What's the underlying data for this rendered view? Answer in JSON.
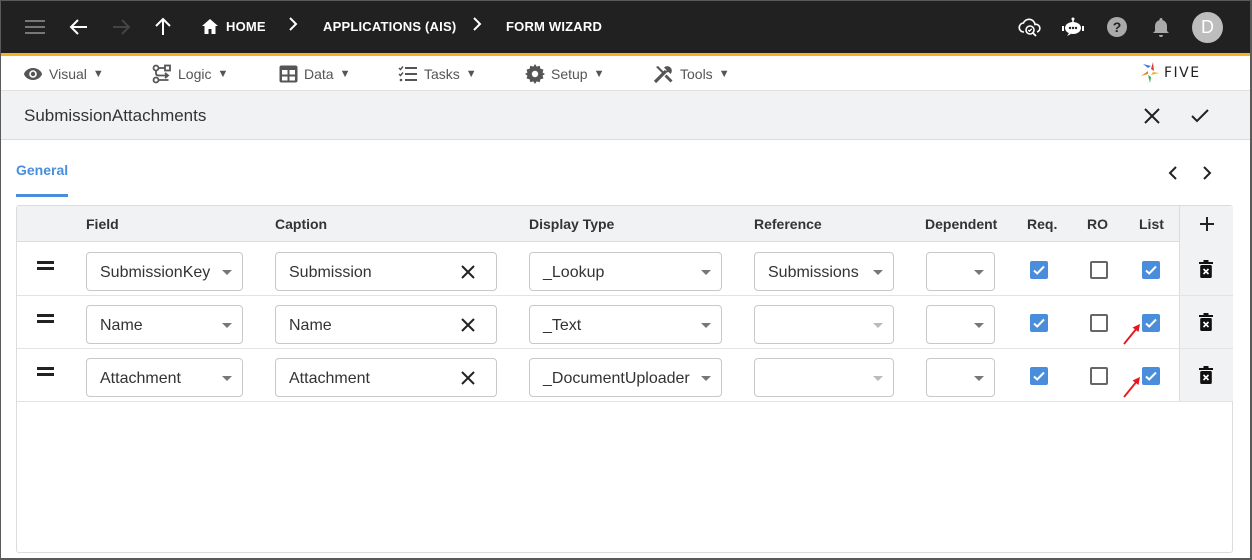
{
  "topbar": {
    "breadcrumbs": [
      "HOME",
      "APPLICATIONS (AIS)",
      "FORM WIZARD"
    ],
    "icons": [
      "menu-icon",
      "back-icon",
      "forward-icon",
      "up-icon",
      "home-icon",
      "cloud-search-icon",
      "chatbot-icon",
      "help-icon",
      "bell-icon"
    ],
    "avatar_initial": "D"
  },
  "menubar": {
    "items": [
      {
        "label": "Visual",
        "icon": "eye-icon"
      },
      {
        "label": "Logic",
        "icon": "logic-icon"
      },
      {
        "label": "Data",
        "icon": "table-icon"
      },
      {
        "label": "Tasks",
        "icon": "tasks-icon"
      },
      {
        "label": "Setup",
        "icon": "gear-icon"
      },
      {
        "label": "Tools",
        "icon": "tools-icon"
      }
    ],
    "caret": "▼",
    "logo_text": "FIVE"
  },
  "form": {
    "title": "SubmissionAttachments",
    "tabs": [
      "General"
    ],
    "active_tab": "General"
  },
  "table": {
    "headers": {
      "field": "Field",
      "caption": "Caption",
      "display_type": "Display Type",
      "reference": "Reference",
      "dependent": "Dependent",
      "req": "Req.",
      "ro": "RO",
      "list": "List"
    },
    "rows": [
      {
        "field": "SubmissionKey",
        "caption": "Submission",
        "display_type": "_Lookup",
        "reference": "Submissions",
        "dependent": "",
        "req": true,
        "ro": false,
        "list": true,
        "annotated": false
      },
      {
        "field": "Name",
        "caption": "Name",
        "display_type": "_Text",
        "reference": "",
        "dependent": "",
        "req": true,
        "ro": false,
        "list": true,
        "annotated": true
      },
      {
        "field": "Attachment",
        "caption": "Attachment",
        "display_type": "_DocumentUploader",
        "reference": "",
        "dependent": "",
        "req": true,
        "ro": false,
        "list": true,
        "annotated": true
      }
    ]
  },
  "colors": {
    "accent": "#4a8edb",
    "topbar": "#212121",
    "topbar_stripe": "#f5b323",
    "annotation": "#e8161b"
  }
}
